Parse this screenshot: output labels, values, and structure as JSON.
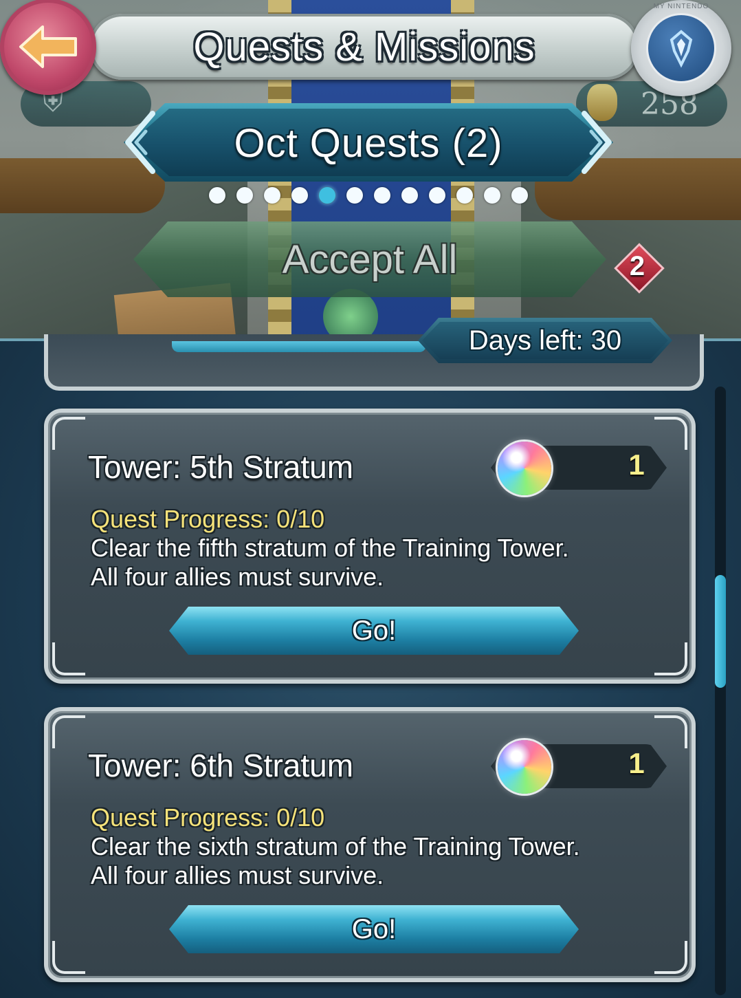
{
  "header": {
    "title": "Quests & Missions",
    "badge_ring_text": "MY NINTENDO",
    "orb_count": "258"
  },
  "selector": {
    "label": "Oct Quests (2)",
    "page_count": 12,
    "active_page_index": 4
  },
  "accept_all": {
    "label": "Accept All",
    "badge_count": "2"
  },
  "days_left": "Days left: 30",
  "quests": [
    {
      "title": "Tower: 5th Stratum",
      "reward_count": "1",
      "progress": "Quest Progress: 0/10",
      "description_line1": "Clear the fifth stratum of the Training Tower.",
      "description_line2": "All four allies must survive.",
      "button": "Go!"
    },
    {
      "title": "Tower: 6th Stratum",
      "reward_count": "1",
      "progress": "Quest Progress: 0/10",
      "description_line1": "Clear the sixth stratum of the Training Tower.",
      "description_line2": "All four allies must survive.",
      "button": "Go!"
    }
  ],
  "icons": {
    "back": "back-arrow-icon",
    "badge": "my-nintendo-badge-icon",
    "stamina": "stamina-icon",
    "orb": "orb-icon",
    "reward": "rainbow-orb-icon",
    "prev": "chevron-left-icon",
    "next": "chevron-right-icon"
  },
  "colors": {
    "accent": "#3fbfe0",
    "progress_text": "#f5e27a",
    "badge_red": "#c0486a",
    "reward_count": "#f7ef8c"
  }
}
